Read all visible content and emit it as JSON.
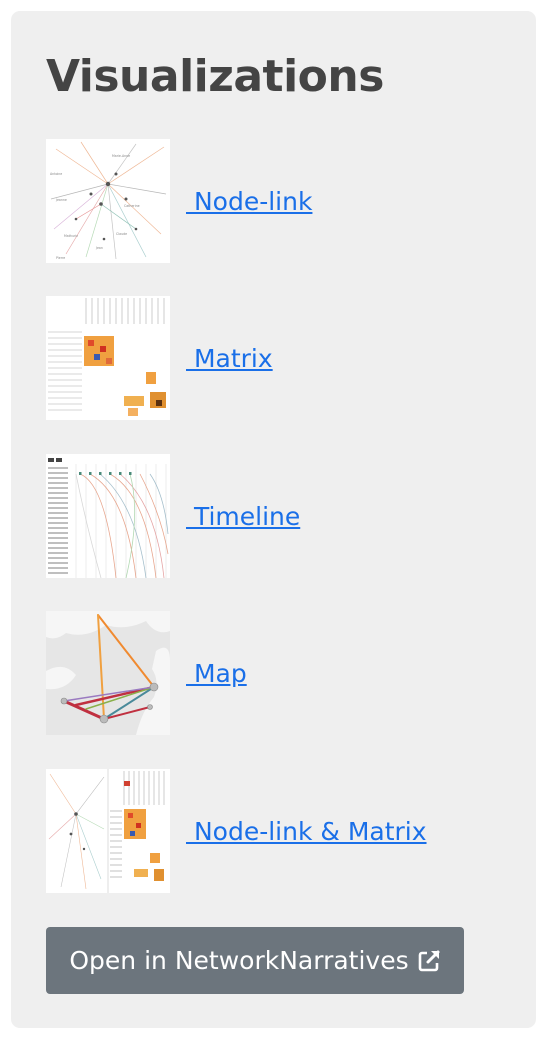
{
  "panel": {
    "title": "Visualizations",
    "items": [
      {
        "label": " Node-link",
        "icon": "node-link-thumbnail"
      },
      {
        "label": " Matrix",
        "icon": "matrix-thumbnail"
      },
      {
        "label": " Timeline",
        "icon": "timeline-thumbnail"
      },
      {
        "label": " Map",
        "icon": "map-thumbnail"
      },
      {
        "label": " Node-link & Matrix",
        "icon": "node-link-matrix-thumbnail"
      }
    ],
    "open_button": {
      "label": "Open in NetworkNarratives",
      "icon": "external-link-icon"
    }
  },
  "colors": {
    "panel_bg": "#efefef",
    "title": "#444444",
    "link": "#1a6fe8",
    "button_bg": "#6c757d",
    "button_text": "#ffffff"
  }
}
